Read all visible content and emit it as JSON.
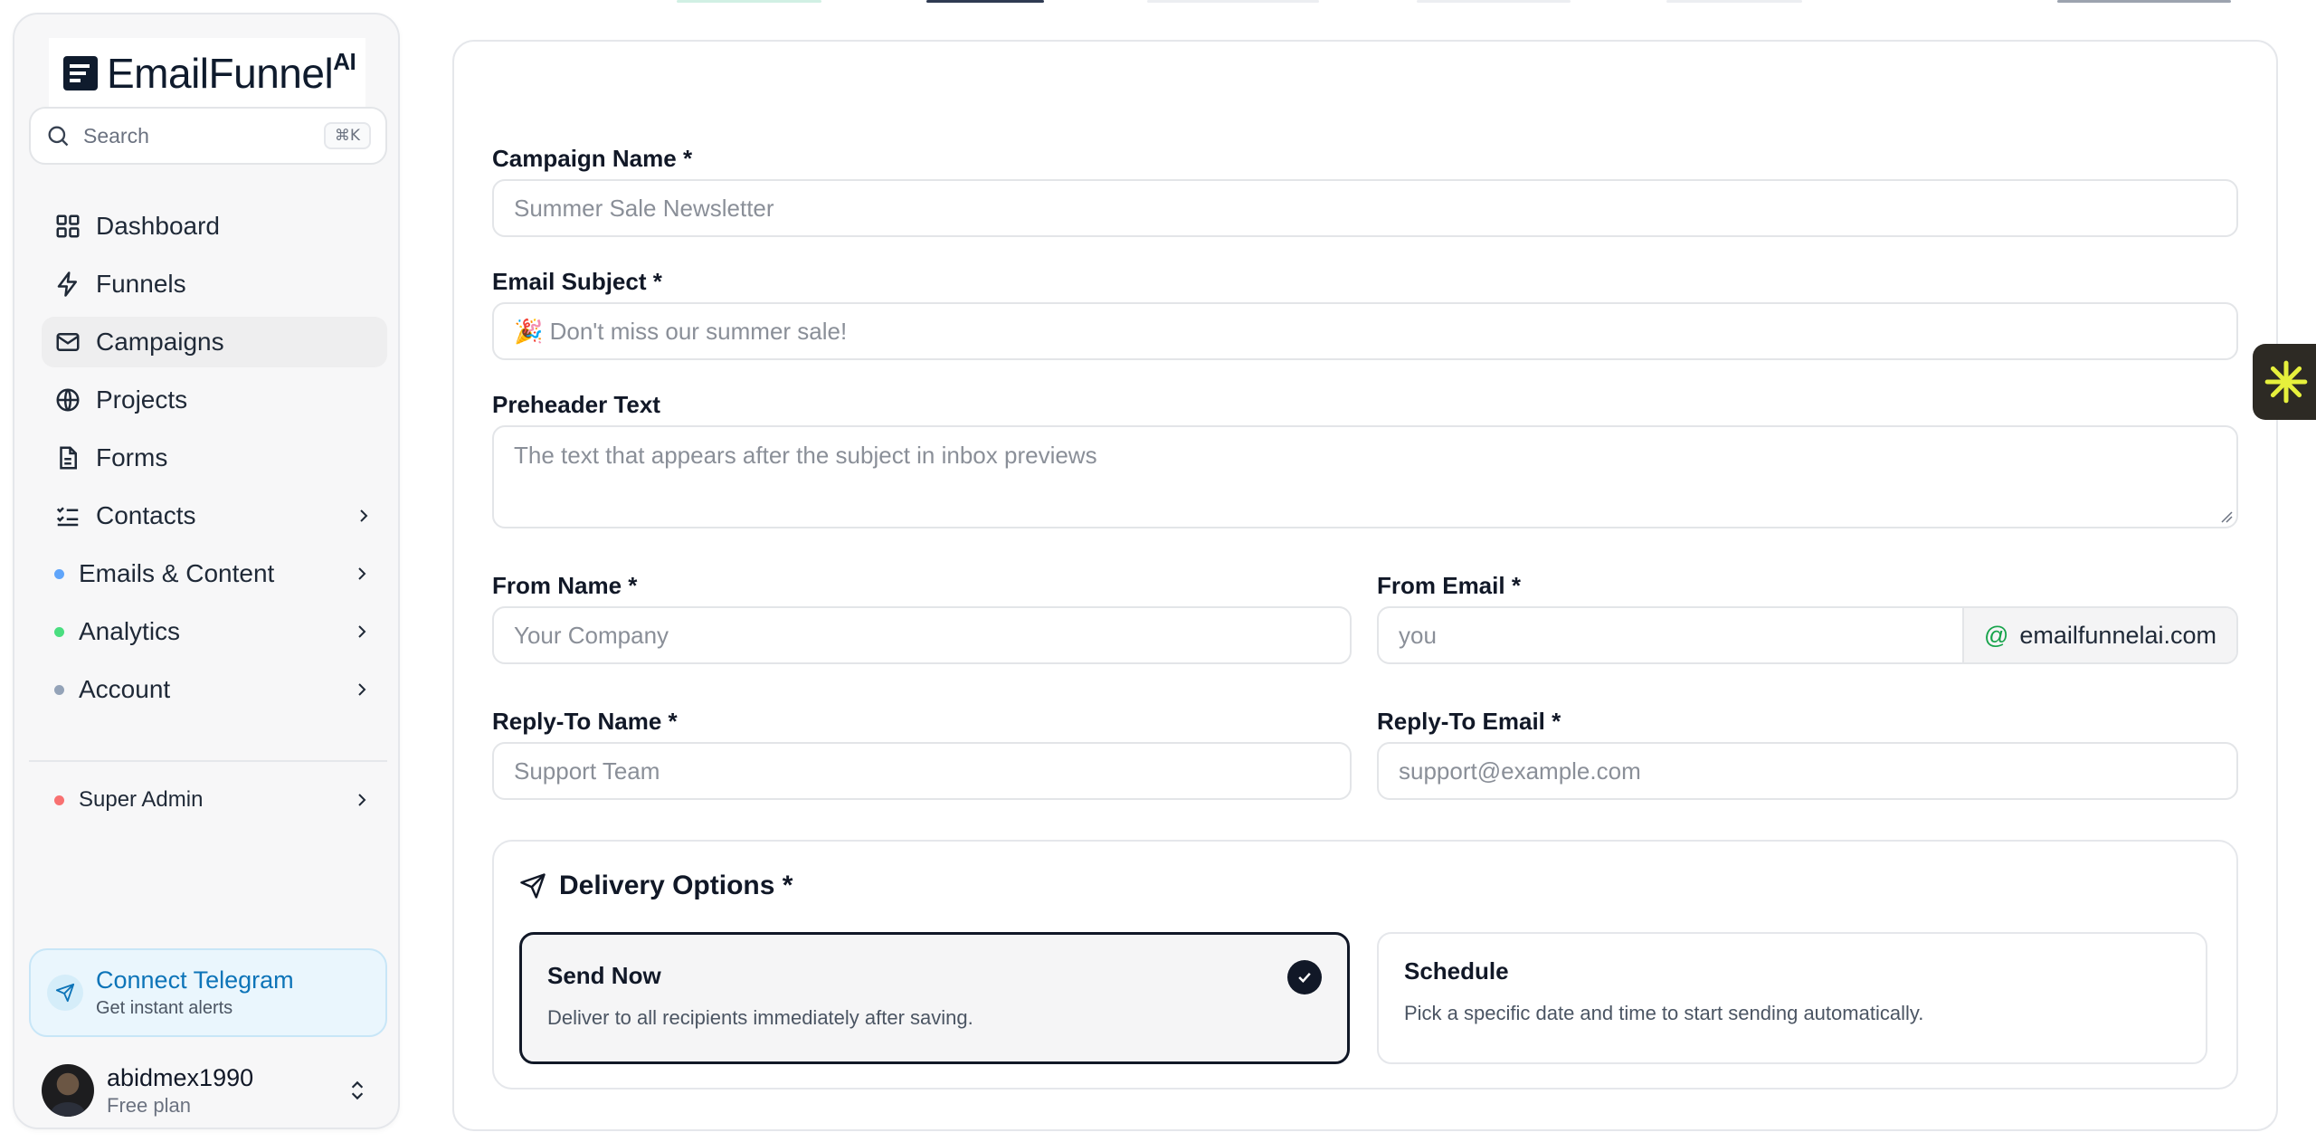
{
  "app": {
    "brand": "EmailFunnel",
    "brand_suffix": "AI"
  },
  "search": {
    "placeholder": "Search",
    "shortcut": "⌘K"
  },
  "nav": {
    "items": [
      {
        "label": "Dashboard",
        "icon": "grid-icon"
      },
      {
        "label": "Funnels",
        "icon": "lightning-icon"
      },
      {
        "label": "Campaigns",
        "icon": "mail-icon",
        "active": true
      },
      {
        "label": "Projects",
        "icon": "globe-icon"
      },
      {
        "label": "Forms",
        "icon": "document-icon"
      },
      {
        "label": "Contacts",
        "icon": "checklist-icon"
      }
    ],
    "groups": [
      {
        "label": "Emails & Content",
        "dot_color": "#60a5fa"
      },
      {
        "label": "Analytics",
        "dot_color": "#4ade80"
      },
      {
        "label": "Account",
        "dot_color": "#94a3b8"
      }
    ],
    "admin": {
      "label": "Super Admin",
      "dot_color": "#f87171"
    }
  },
  "telegram": {
    "title": "Connect Telegram",
    "subtitle": "Get instant alerts"
  },
  "user": {
    "name": "abidmex1990",
    "plan": "Free plan"
  },
  "form": {
    "campaign_name": {
      "label": "Campaign Name *",
      "placeholder": "Summer Sale Newsletter"
    },
    "email_subject": {
      "label": "Email Subject *",
      "placeholder": "🎉 Don't miss our summer sale!"
    },
    "preheader": {
      "label": "Preheader Text",
      "placeholder": "The text that appears after the subject in inbox previews"
    },
    "from_name": {
      "label": "From Name *",
      "placeholder": "Your Company"
    },
    "from_email": {
      "label": "From Email *",
      "placeholder": "you",
      "domain": "emailfunnelai.com"
    },
    "reply_to_name": {
      "label": "Reply-To Name *",
      "placeholder": "Support Team"
    },
    "reply_to_email": {
      "label": "Reply-To Email *",
      "placeholder": "support@example.com"
    }
  },
  "delivery": {
    "title": "Delivery Options *",
    "options": [
      {
        "title": "Send Now",
        "description": "Deliver to all recipients immediately after saving.",
        "selected": true
      },
      {
        "title": "Schedule",
        "description": "Pick a specific date and time to start sending automatically.",
        "selected": false
      }
    ]
  },
  "colors": {
    "accent": "#111827",
    "telegram": "#0d74b8",
    "float_button": "#2d2a24",
    "float_icon": "#e6f03c"
  }
}
